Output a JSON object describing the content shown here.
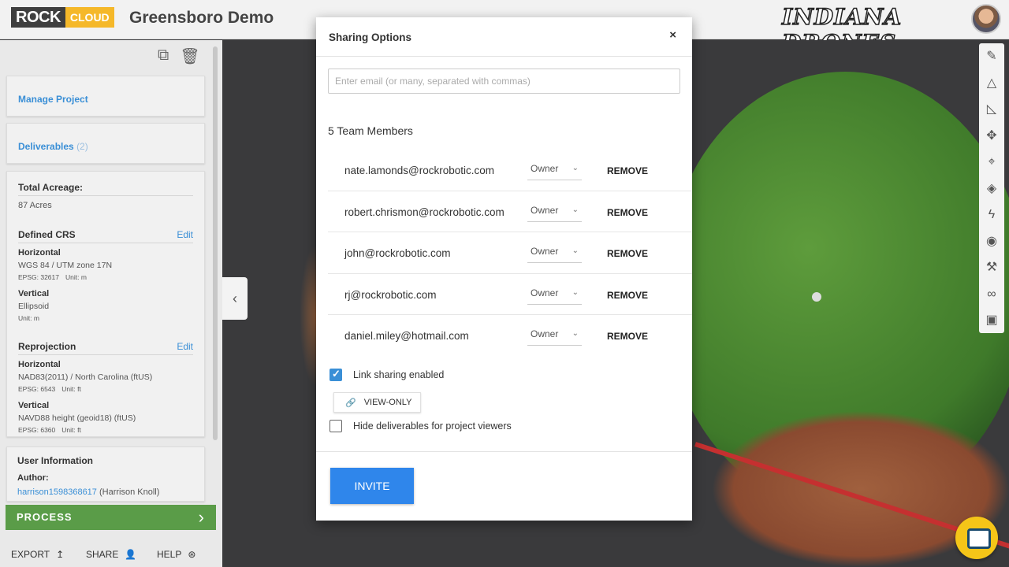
{
  "header": {
    "logo_rock": "ROCK",
    "logo_cloud": "CLOUD",
    "project_title": "Greensboro Demo",
    "brand_text": "INDIANA DRONES"
  },
  "sidebar": {
    "manage_project": "Manage Project",
    "deliverables_label": "Deliverables",
    "deliverables_count": "(2)",
    "total_acreage_label": "Total Acreage:",
    "total_acreage_value": "87 Acres",
    "defined_crs": {
      "title": "Defined CRS",
      "edit": "Edit",
      "horizontal_label": "Horizontal",
      "horizontal_value": "WGS 84 / UTM zone 17N",
      "horizontal_epsg": "EPSG: 32617",
      "horizontal_unit": "Unit: m",
      "vertical_label": "Vertical",
      "vertical_value": "Ellipsoid",
      "vertical_unit": "Unit: m"
    },
    "reprojection": {
      "title": "Reprojection",
      "edit": "Edit",
      "horizontal_label": "Horizontal",
      "horizontal_value": "NAD83(2011) / North Carolina (ftUS)",
      "horizontal_epsg": "EPSG: 6543",
      "horizontal_unit": "Unit: ft",
      "vertical_label": "Vertical",
      "vertical_value": "NAVD88 height (geoid18) (ftUS)",
      "vertical_epsg": "EPSG: 6360",
      "vertical_unit": "Unit: ft"
    },
    "user_info": {
      "title": "User Information",
      "author_label": "Author:",
      "author_user": "harrison1598368617",
      "author_name": "(Harrison Knoll)"
    },
    "process_label": "PROCESS",
    "export_label": "EXPORT",
    "share_label": "SHARE",
    "help_label": "HELP"
  },
  "modal": {
    "title": "Sharing Options",
    "close": "×",
    "email_placeholder": "Enter email (or many, separated with commas)",
    "team_count": "5 Team Members",
    "members": [
      {
        "email": "nate.lamonds@rockrobotic.com",
        "role": "Owner",
        "action": "REMOVE"
      },
      {
        "email": "robert.chrismon@rockrobotic.com",
        "role": "Owner",
        "action": "REMOVE"
      },
      {
        "email": "john@rockrobotic.com",
        "role": "Owner",
        "action": "REMOVE"
      },
      {
        "email": "rj@rockrobotic.com",
        "role": "Owner",
        "action": "REMOVE"
      },
      {
        "email": "daniel.miley@hotmail.com",
        "role": "Owner",
        "action": "REMOVE"
      }
    ],
    "link_sharing_label": "Link sharing enabled",
    "link_sharing_checked": true,
    "view_only_label": "VIEW-ONLY",
    "hide_deliverables_label": "Hide deliverables for project viewers",
    "hide_deliverables_checked": false,
    "invite_label": "INVITE"
  },
  "colors": {
    "accent_blue": "#2f86eb",
    "link_blue": "#3a8fd6",
    "process_green": "#5a9c48",
    "logo_yellow": "#f5b829"
  }
}
